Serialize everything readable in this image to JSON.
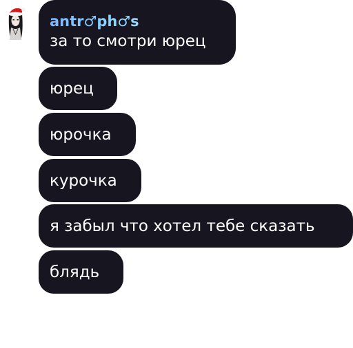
{
  "chat": {
    "sender": {
      "name": "antr♂ph♂s",
      "name_color": "#86c4ff"
    },
    "avatar_icon": "santa-hat-girl-avatar-icon",
    "bubble_color": "#17151f",
    "messages": [
      "за то смотри юрец",
      "юрец",
      "юрочка",
      "курочка",
      "я забыл что хотел тебе сказать",
      "блядь"
    ]
  }
}
